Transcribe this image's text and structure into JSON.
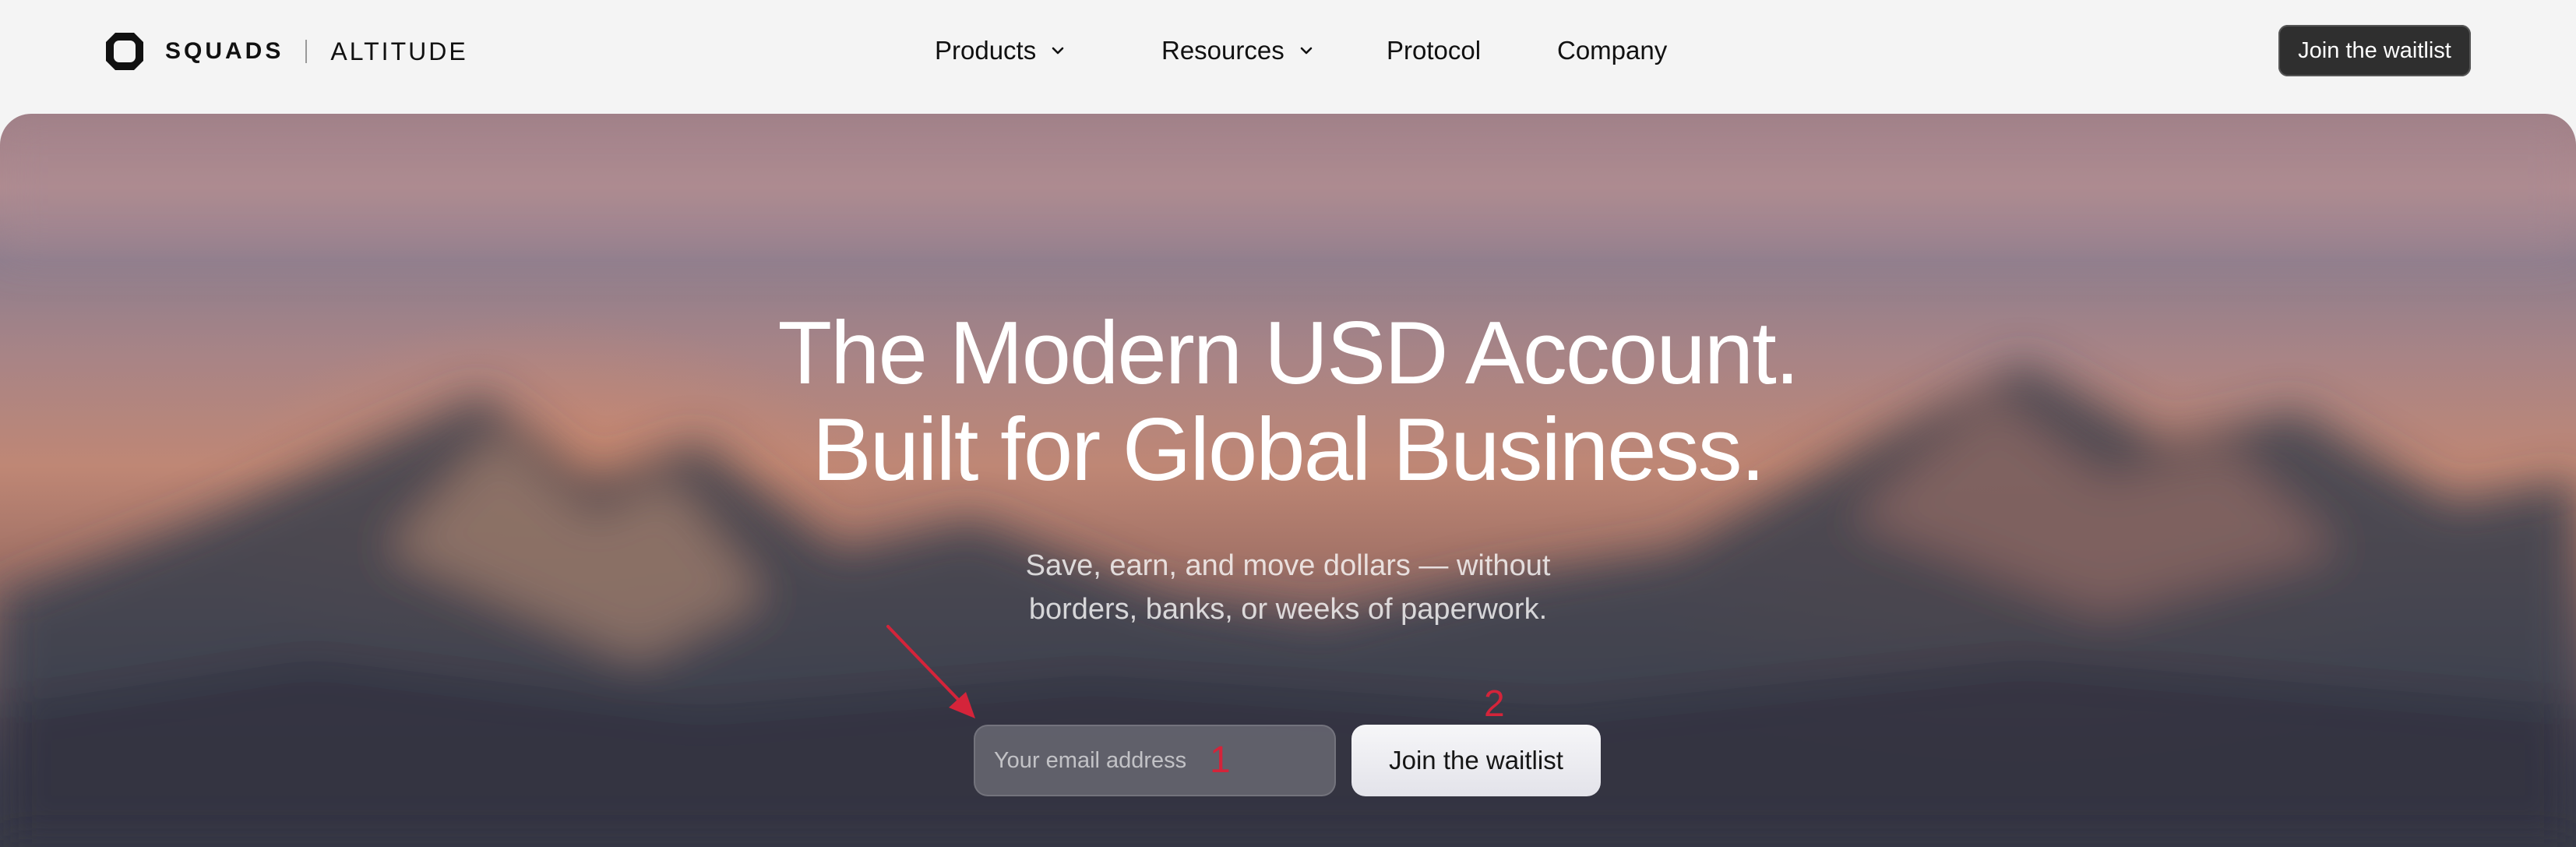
{
  "brand": {
    "wordmark": "SQUADS",
    "product": "ALTITUDE"
  },
  "nav": {
    "items": [
      {
        "label": "Products",
        "has_dropdown": true
      },
      {
        "label": "Resources",
        "has_dropdown": true
      },
      {
        "label": "Protocol",
        "has_dropdown": false
      },
      {
        "label": "Company",
        "has_dropdown": false
      }
    ],
    "cta_label": "Join the waitlist"
  },
  "hero": {
    "headline_line1": "The Modern USD Account.",
    "headline_line2": "Built for Global Business.",
    "sub_line1": "Save, earn, and move dollars — without",
    "sub_line2": "borders, banks, or weeks of paperwork.",
    "email_placeholder": "Your email address",
    "cta_label": "Join the waitlist"
  },
  "annotations": {
    "marker_1": "1",
    "marker_2": "2"
  },
  "colors": {
    "nav_bg": "#f4f4f4",
    "nav_cta_bg": "#2f2f2f",
    "annotation": "#d4243a",
    "hero_text": "#ffffff"
  },
  "icons": {
    "logo": "squads-logo-icon",
    "dropdown": "chevron-down-icon"
  }
}
